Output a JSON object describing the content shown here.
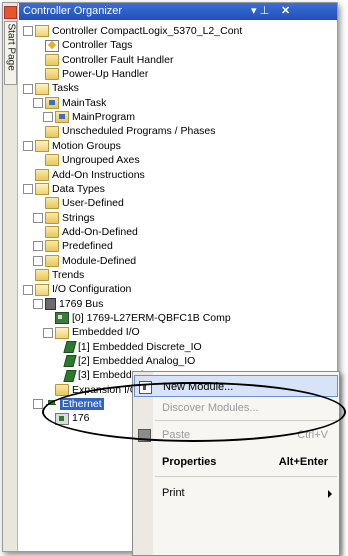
{
  "side_tab": {
    "label": "Start Page"
  },
  "panel": {
    "title": "Controller Organizer",
    "pin": "▾ ⊥",
    "close": "✕"
  },
  "tree": [
    {
      "label": "Controller CompactLogix_5370_L2_Cont",
      "indent": 0,
      "expander": "−",
      "icon": "folder-open"
    },
    {
      "label": "Controller Tags",
      "indent": 1,
      "expander": "",
      "icon": "tag"
    },
    {
      "label": "Controller Fault Handler",
      "indent": 1,
      "expander": "",
      "icon": "folder"
    },
    {
      "label": "Power-Up Handler",
      "indent": 1,
      "expander": "",
      "icon": "folder"
    },
    {
      "label": "Tasks",
      "indent": 0,
      "expander": "−",
      "icon": "folder-open"
    },
    {
      "label": "MainTask",
      "indent": 1,
      "expander": "−",
      "icon": "prog"
    },
    {
      "label": "MainProgram",
      "indent": 2,
      "expander": "+",
      "icon": "prog"
    },
    {
      "label": "Unscheduled Programs / Phases",
      "indent": 1,
      "expander": "",
      "icon": "folder"
    },
    {
      "label": "Motion Groups",
      "indent": 0,
      "expander": "−",
      "icon": "folder-open"
    },
    {
      "label": "Ungrouped Axes",
      "indent": 1,
      "expander": "",
      "icon": "folder"
    },
    {
      "label": "Add-On Instructions",
      "indent": 0,
      "expander": "",
      "icon": "folder"
    },
    {
      "label": "Data Types",
      "indent": 0,
      "expander": "−",
      "icon": "folder-open"
    },
    {
      "label": "User-Defined",
      "indent": 1,
      "expander": "",
      "icon": "folder"
    },
    {
      "label": "Strings",
      "indent": 1,
      "expander": "+",
      "icon": "folder"
    },
    {
      "label": "Add-On-Defined",
      "indent": 1,
      "expander": "",
      "icon": "folder"
    },
    {
      "label": "Predefined",
      "indent": 1,
      "expander": "+",
      "icon": "folder"
    },
    {
      "label": "Module-Defined",
      "indent": 1,
      "expander": "+",
      "icon": "folder"
    },
    {
      "label": "Trends",
      "indent": 0,
      "expander": "",
      "icon": "folder"
    },
    {
      "label": "I/O Configuration",
      "indent": 0,
      "expander": "−",
      "icon": "folder-open"
    },
    {
      "label": "1769 Bus",
      "indent": 1,
      "expander": "−",
      "icon": "bus"
    },
    {
      "label": "[0] 1769-L27ERM-QBFC1B Comp",
      "indent": 2,
      "expander": "",
      "icon": "module"
    },
    {
      "label": "Embedded I/O",
      "indent": 2,
      "expander": "−",
      "icon": "folder-open"
    },
    {
      "label": "[1] Embedded Discrete_IO",
      "indent": 3,
      "expander": "",
      "icon": "chip"
    },
    {
      "label": "[2] Embedded Analog_IO",
      "indent": 3,
      "expander": "",
      "icon": "chip"
    },
    {
      "label": "[3] Embedded Counters",
      "indent": 3,
      "expander": "",
      "icon": "chip"
    },
    {
      "label": "Expansion I/O",
      "indent": 2,
      "expander": "",
      "icon": "folder"
    },
    {
      "label": "Ethernet",
      "indent": 1,
      "expander": "−",
      "icon": "net",
      "selected": true
    },
    {
      "label": "176",
      "indent": 2,
      "expander": "",
      "icon": "cyl"
    }
  ],
  "context_menu": {
    "items": [
      {
        "label": "New Module...",
        "shortcut": "",
        "disabled": false,
        "bold": false,
        "highlighted": true,
        "icon": "new-module"
      },
      {
        "label": "Discover Modules...",
        "shortcut": "",
        "disabled": true,
        "bold": false,
        "highlighted": false,
        "icon": ""
      },
      {
        "label": "Paste",
        "shortcut": "Ctrl+V",
        "disabled": true,
        "bold": false,
        "highlighted": false,
        "icon": "paste"
      },
      {
        "label": "Properties",
        "shortcut": "Alt+Enter",
        "disabled": false,
        "bold": true,
        "highlighted": false,
        "icon": ""
      },
      {
        "label": "Print",
        "shortcut": "",
        "disabled": false,
        "bold": false,
        "highlighted": false,
        "icon": "",
        "submenu": true
      }
    ]
  }
}
